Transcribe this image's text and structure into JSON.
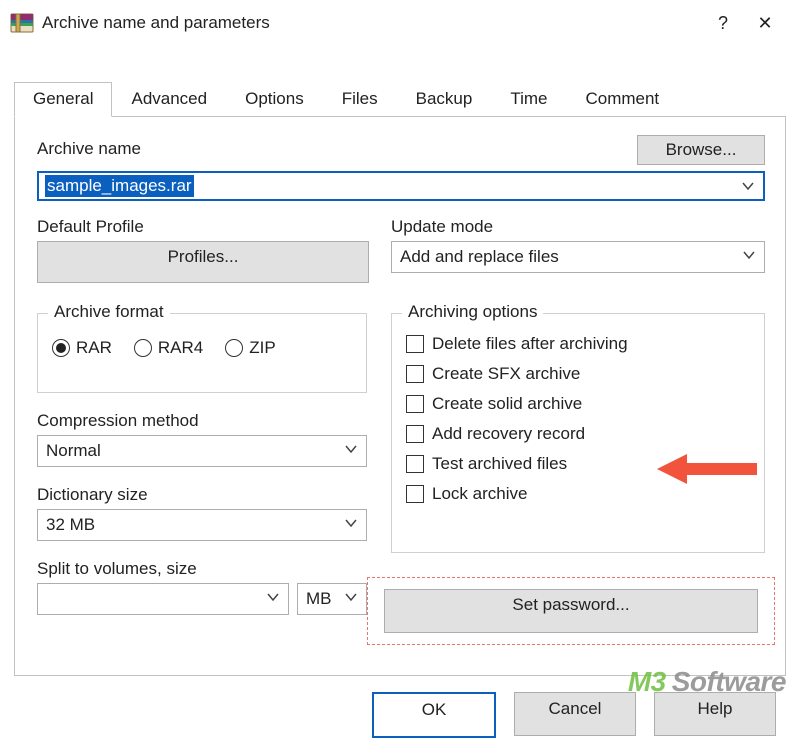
{
  "window": {
    "title": "Archive name and parameters",
    "help_glyph": "?",
    "close_glyph": "✕"
  },
  "tabs": [
    {
      "label": "General"
    },
    {
      "label": "Advanced"
    },
    {
      "label": "Options"
    },
    {
      "label": "Files"
    },
    {
      "label": "Backup"
    },
    {
      "label": "Time"
    },
    {
      "label": "Comment"
    }
  ],
  "archive_name": {
    "label": "Archive name",
    "value": "sample_images.rar",
    "browse": "Browse..."
  },
  "default_profile": {
    "label": "Default Profile",
    "button": "Profiles..."
  },
  "update_mode": {
    "label": "Update mode",
    "value": "Add and replace files"
  },
  "archive_format": {
    "legend": "Archive format",
    "options": [
      {
        "label": "RAR",
        "selected": true
      },
      {
        "label": "RAR4",
        "selected": false
      },
      {
        "label": "ZIP",
        "selected": false
      }
    ]
  },
  "compression_method": {
    "label": "Compression method",
    "value": "Normal"
  },
  "dictionary_size": {
    "label": "Dictionary size",
    "value": "32 MB"
  },
  "split_volumes": {
    "label": "Split to volumes, size",
    "value": "",
    "unit": "MB"
  },
  "archiving_options": {
    "legend": "Archiving options",
    "items": [
      {
        "label": "Delete files after archiving"
      },
      {
        "label": "Create SFX archive"
      },
      {
        "label": "Create solid archive"
      },
      {
        "label": "Add recovery record"
      },
      {
        "label": "Test archived files"
      },
      {
        "label": "Lock archive"
      }
    ]
  },
  "set_password": {
    "label": "Set password..."
  },
  "buttons": {
    "ok": "OK",
    "cancel": "Cancel",
    "help": "Help"
  },
  "watermark": {
    "prefix": "M3",
    "suffix": "Software"
  }
}
